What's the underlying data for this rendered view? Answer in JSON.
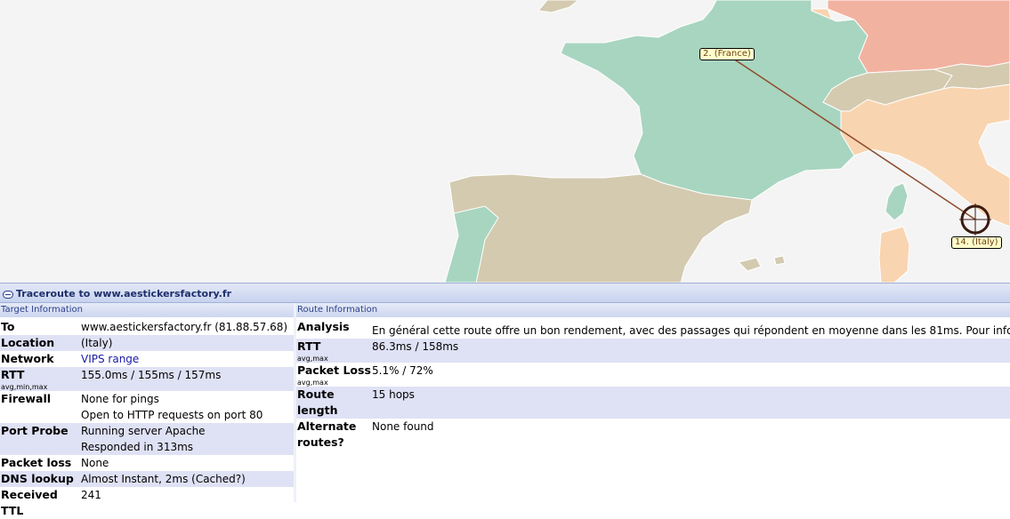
{
  "map": {
    "hops": [
      {
        "label": "2. (France)"
      },
      {
        "label": "14. (Italy)"
      }
    ],
    "colors": {
      "sea": "#f4f4f4",
      "france": "#a8d5c0",
      "spain": "#d3cab0",
      "portugal": "#a8d5c0",
      "italy": "#f9d4b0",
      "swiss": "#d3cab0",
      "germany": "#f2b2a0",
      "route": "#8b4c2a"
    }
  },
  "panel": {
    "title": "Traceroute to www.aestickersfactory.fr",
    "target_header": "Target Information",
    "route_header": "Route Information"
  },
  "target": {
    "to_label": "To",
    "to_value": "www.aestickersfactory.fr (81.88.57.68)",
    "location_label": "Location",
    "location_value": "(Italy)",
    "network_label": "Network",
    "network_value": "VIPS range",
    "rtt_label": "RTT",
    "rtt_sub": "avg,min,max",
    "rtt_value": "155.0ms / 155ms / 157ms",
    "firewall_label": "Firewall",
    "firewall_value1": "None for pings",
    "firewall_value2": "Open to HTTP requests on port 80",
    "probe_label": "Port Probe",
    "probe_value1": "Running server Apache",
    "probe_value2": "Responded in 313ms",
    "loss_label": "Packet loss",
    "loss_value": "None",
    "dns_label": "DNS lookup",
    "dns_value": "Almost Instant, 2ms (Cached?)",
    "ttl_label": "Received TTL",
    "ttl_value": "241"
  },
  "route": {
    "analysis_label": "Analysis",
    "analysis_value": "En général cette route offre un bon rendement, avec des passages qui répondent en moyenne dans les 81ms. Pour informat",
    "rtt_label": "RTT",
    "rtt_sub": "avg,max",
    "rtt_value": "86.3ms / 158ms",
    "loss_label": "Packet Loss",
    "loss_sub": "avg,max",
    "loss_value": "5.1% / 72%",
    "length_label": "Route length",
    "length_value": "15 hops",
    "alt_label": "Alternate routes?",
    "alt_value": "None found"
  }
}
